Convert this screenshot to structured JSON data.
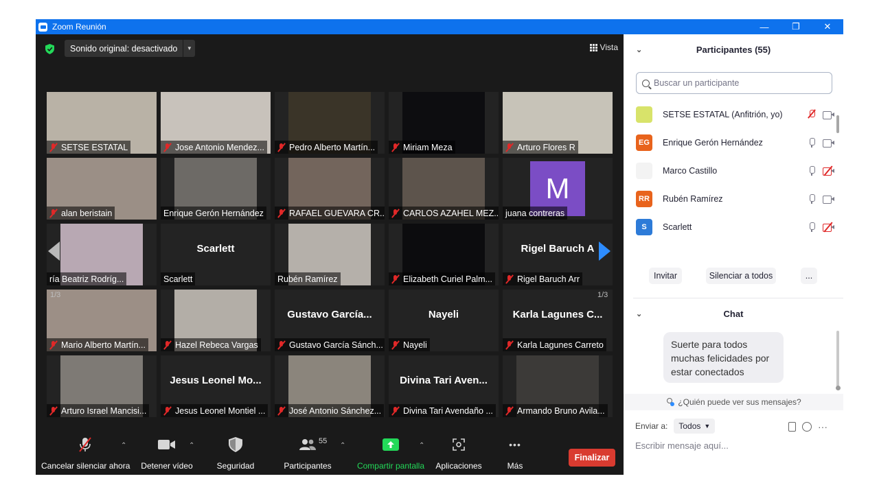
{
  "window": {
    "title": "Zoom Reunión",
    "minimize": "—",
    "restore": "❐",
    "close": "✕"
  },
  "top": {
    "audio_label": "Sonido original: desactivado",
    "audio_dropdown": "▼",
    "view_label": "Vista"
  },
  "gallery": {
    "page_left": "1/3",
    "page_right": "1/3",
    "tiles": [
      {
        "name": "SETSE ESTATAL",
        "muted": true,
        "bg": "#b9b2a6"
      },
      {
        "name": "Jose Antonio Mendez...",
        "muted": true,
        "bg": "#c8c2bb"
      },
      {
        "name": "Pedro Alberto Martín...",
        "muted": true,
        "bg": "#3a3428"
      },
      {
        "name": "Miriam Meza",
        "muted": true,
        "bg": "#0d0d10"
      },
      {
        "name": "Arturo Flores R",
        "muted": true,
        "bg": "#c7c3b8"
      },
      {
        "name": "alan beristain",
        "muted": true,
        "bg": "#9b8f86"
      },
      {
        "name": "Enrique Gerón Hernández",
        "muted": false,
        "bg": "#6d6a66"
      },
      {
        "name": "RAFAEL GUEVARA CR...",
        "muted": true,
        "bg": "#73655c"
      },
      {
        "name": "CARLOS AZAHEL MEZ...",
        "muted": true,
        "bg": "#5d544c"
      },
      {
        "name": "juana contreras",
        "muted": false,
        "avatar": "M"
      },
      {
        "name": "ría Beatriz Rodríg...",
        "muted": false,
        "bg": "#b8a8b3"
      },
      {
        "name": "Scarlett",
        "muted": false,
        "big": "Scarlett"
      },
      {
        "name": "Rubén Ramírez",
        "muted": false,
        "bg": "#b5b0aa"
      },
      {
        "name": "Elizabeth Curiel Palm...",
        "muted": true,
        "bg": "#0c0c0e"
      },
      {
        "name": "Rigel Baruch Arr",
        "muted": true,
        "big": "Rigel Baruch A"
      },
      {
        "name": "Mario Alberto Martín...",
        "muted": true,
        "bg": "#9c8f86"
      },
      {
        "name": "Hazel Rebeca Vargas",
        "muted": true,
        "bg": "#b3aea7"
      },
      {
        "name": "Gustavo García Sánch...",
        "muted": true,
        "big": "Gustavo García..."
      },
      {
        "name": "Nayeli",
        "muted": true,
        "big": "Nayeli"
      },
      {
        "name": "Karla Lagunes Carreto",
        "muted": true,
        "big": "Karla Lagunes C..."
      },
      {
        "name": "Arturo Israel Mancisi...",
        "muted": true,
        "bg": "#7e7a75"
      },
      {
        "name": "Jesus Leonel Montiel ...",
        "muted": true,
        "big": "Jesus Leonel Mo..."
      },
      {
        "name": "José Antonio Sánchez...",
        "muted": true,
        "bg": "#8b857c"
      },
      {
        "name": "Divina Tari Avendaño ...",
        "muted": true,
        "big": "Divina Tari Aven..."
      },
      {
        "name": "Armando Bruno Avila...",
        "muted": true,
        "bg": "#3c3a38"
      }
    ]
  },
  "toolbar": {
    "unmute": "Cancelar silenciar ahora",
    "video": "Detener vídeo",
    "security": "Seguridad",
    "participants": "Participantes",
    "participants_count": "55",
    "share": "Compartir pantalla",
    "apps": "Aplicaciones",
    "more": "Más",
    "end": "Finalizar",
    "more_glyph": "•••"
  },
  "participants_panel": {
    "title": "Participantes (55)",
    "search_placeholder": "Buscar un participante",
    "list": [
      {
        "name": "SETSE ESTATAL (Anfitrión, yo)",
        "initials": "",
        "color": "#d8e36a",
        "mic_muted": true,
        "cam_off": false
      },
      {
        "name": "Enrique Gerón Hernández",
        "initials": "EG",
        "color": "#e8631c",
        "mic_muted": false,
        "cam_off": false
      },
      {
        "name": "Marco Castillo",
        "initials": "",
        "color": "#f3f3f3",
        "mic_muted": false,
        "cam_off": true
      },
      {
        "name": "Rubén Ramírez",
        "initials": "RR",
        "color": "#e8631c",
        "mic_muted": false,
        "cam_off": false
      },
      {
        "name": "Scarlett",
        "initials": "S",
        "color": "#2d7bd8",
        "mic_muted": false,
        "cam_off": true
      }
    ],
    "invite": "Invitar",
    "mute_all": "Silenciar a todos",
    "more": "..."
  },
  "chat": {
    "title": "Chat",
    "message": "Suerte para todos muchas felicidades por estar conectados",
    "who_can_see": "¿Quién puede ver sus mensajes?",
    "send_to_label": "Enviar a:",
    "send_to_value": "Todos",
    "input_placeholder": "Escribir mensaje aquí...",
    "more": "···"
  }
}
